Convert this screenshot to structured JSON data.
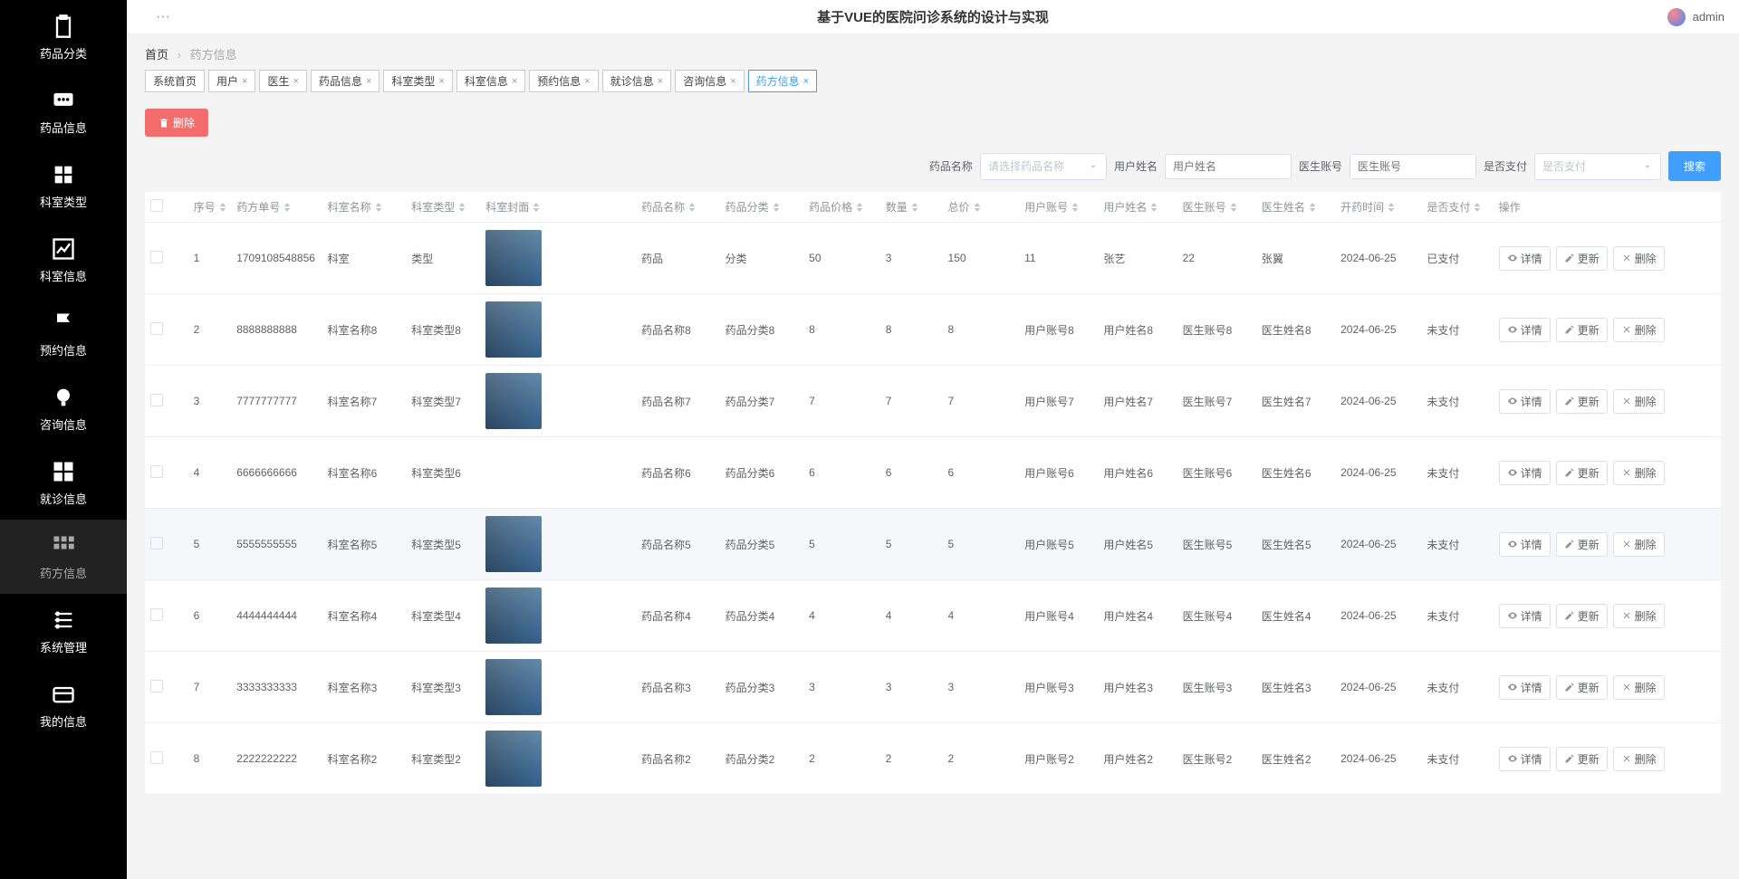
{
  "header": {
    "title": "基于VUE的医院问诊系统的设计与实现",
    "user": "admin",
    "dots": "···"
  },
  "sidebar": {
    "items": [
      {
        "label": "药品分类",
        "icon": "clipboard"
      },
      {
        "label": "药品信息",
        "icon": "chat"
      },
      {
        "label": "科室类型",
        "icon": "grid"
      },
      {
        "label": "科室信息",
        "icon": "chart"
      },
      {
        "label": "预约信息",
        "icon": "flag"
      },
      {
        "label": "咨询信息",
        "icon": "bulb"
      },
      {
        "label": "就诊信息",
        "icon": "grid2"
      },
      {
        "label": "药方信息",
        "icon": "grid3"
      },
      {
        "label": "系统管理",
        "icon": "menu"
      },
      {
        "label": "我的信息",
        "icon": "card"
      }
    ],
    "active_index": 7
  },
  "breadcrumb": {
    "home": "首页",
    "current": "药方信息"
  },
  "tabs": [
    {
      "label": "系统首页",
      "closable": false
    },
    {
      "label": "用户",
      "closable": true
    },
    {
      "label": "医生",
      "closable": true
    },
    {
      "label": "药品信息",
      "closable": true
    },
    {
      "label": "科室类型",
      "closable": true
    },
    {
      "label": "科室信息",
      "closable": true
    },
    {
      "label": "预约信息",
      "closable": true
    },
    {
      "label": "就诊信息",
      "closable": true
    },
    {
      "label": "咨询信息",
      "closable": true
    },
    {
      "label": "药方信息",
      "closable": true,
      "active": true
    }
  ],
  "toolbar": {
    "delete_label": "删除"
  },
  "filters": {
    "f1_label": "药品名称",
    "f1_placeholder": "请选择药品名称",
    "f2_label": "用户姓名",
    "f2_placeholder": "用户姓名",
    "f3_label": "医生账号",
    "f3_placeholder": "医生账号",
    "f4_label": "是否支付",
    "f4_placeholder": "是否支付",
    "search": "搜索"
  },
  "table": {
    "headers": [
      "序号",
      "药方单号",
      "科室名称",
      "科室类型",
      "科室封面",
      "药品名称",
      "药品分类",
      "药品价格",
      "数量",
      "总价",
      "用户账号",
      "用户姓名",
      "医生账号",
      "医生姓名",
      "开药时间",
      "是否支付",
      "操作"
    ],
    "actions": {
      "detail": "详情",
      "update": "更新",
      "delete": "删除"
    },
    "rows": [
      {
        "idx": "1",
        "no": "1709108548856",
        "ks": "科室",
        "ty": "类型",
        "img": true,
        "name": "药品",
        "cat": "分类",
        "price": "50",
        "qty": "3",
        "total": "150",
        "uacc": "11",
        "uname": "张艺",
        "dacc": "22",
        "dname": "张翼",
        "date": "2024-06-25",
        "pay": "已支付"
      },
      {
        "idx": "2",
        "no": "8888888888",
        "ks": "科室名称8",
        "ty": "科室类型8",
        "img": true,
        "name": "药品名称8",
        "cat": "药品分类8",
        "price": "8",
        "qty": "8",
        "total": "8",
        "uacc": "用户账号8",
        "uname": "用户姓名8",
        "dacc": "医生账号8",
        "dname": "医生姓名8",
        "date": "2024-06-25",
        "pay": "未支付"
      },
      {
        "idx": "3",
        "no": "7777777777",
        "ks": "科室名称7",
        "ty": "科室类型7",
        "img": true,
        "name": "药品名称7",
        "cat": "药品分类7",
        "price": "7",
        "qty": "7",
        "total": "7",
        "uacc": "用户账号7",
        "uname": "用户姓名7",
        "dacc": "医生账号7",
        "dname": "医生姓名7",
        "date": "2024-06-25",
        "pay": "未支付"
      },
      {
        "idx": "4",
        "no": "6666666666",
        "ks": "科室名称6",
        "ty": "科室类型6",
        "img": false,
        "name": "药品名称6",
        "cat": "药品分类6",
        "price": "6",
        "qty": "6",
        "total": "6",
        "uacc": "用户账号6",
        "uname": "用户姓名6",
        "dacc": "医生账号6",
        "dname": "医生姓名6",
        "date": "2024-06-25",
        "pay": "未支付"
      },
      {
        "idx": "5",
        "no": "5555555555",
        "ks": "科室名称5",
        "ty": "科室类型5",
        "img": true,
        "name": "药品名称5",
        "cat": "药品分类5",
        "price": "5",
        "qty": "5",
        "total": "5",
        "uacc": "用户账号5",
        "uname": "用户姓名5",
        "dacc": "医生账号5",
        "dname": "医生姓名5",
        "date": "2024-06-25",
        "pay": "未支付",
        "hover": true
      },
      {
        "idx": "6",
        "no": "4444444444",
        "ks": "科室名称4",
        "ty": "科室类型4",
        "img": true,
        "name": "药品名称4",
        "cat": "药品分类4",
        "price": "4",
        "qty": "4",
        "total": "4",
        "uacc": "用户账号4",
        "uname": "用户姓名4",
        "dacc": "医生账号4",
        "dname": "医生姓名4",
        "date": "2024-06-25",
        "pay": "未支付"
      },
      {
        "idx": "7",
        "no": "3333333333",
        "ks": "科室名称3",
        "ty": "科室类型3",
        "img": true,
        "name": "药品名称3",
        "cat": "药品分类3",
        "price": "3",
        "qty": "3",
        "total": "3",
        "uacc": "用户账号3",
        "uname": "用户姓名3",
        "dacc": "医生账号3",
        "dname": "医生姓名3",
        "date": "2024-06-25",
        "pay": "未支付"
      },
      {
        "idx": "8",
        "no": "2222222222",
        "ks": "科室名称2",
        "ty": "科室类型2",
        "img": true,
        "name": "药品名称2",
        "cat": "药品分类2",
        "price": "2",
        "qty": "2",
        "total": "2",
        "uacc": "用户账号2",
        "uname": "用户姓名2",
        "dacc": "医生账号2",
        "dname": "医生姓名2",
        "date": "2024-06-25",
        "pay": "未支付"
      }
    ]
  }
}
